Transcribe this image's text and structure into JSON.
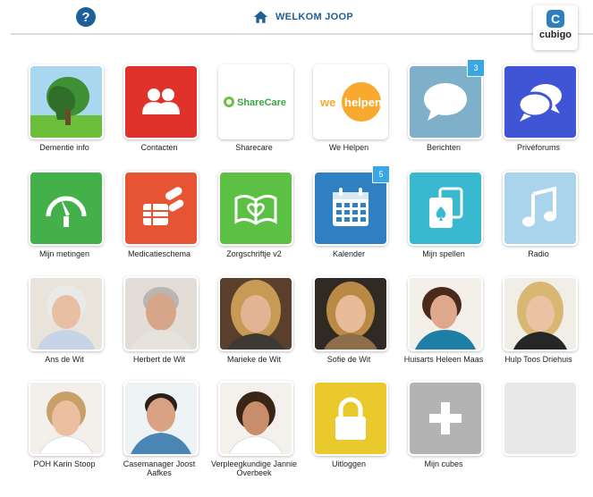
{
  "header": {
    "help_icon": "?",
    "home_icon": "home-icon",
    "title": "WELKOM JOOP",
    "brand_letter": "C",
    "brand_name": "cubigo"
  },
  "tiles": [
    {
      "label": "Dementie info",
      "icon": "tree-head-photo"
    },
    {
      "label": "Contacten",
      "icon": "contacts-icon",
      "color": "#e0322b"
    },
    {
      "label": "Sharecare",
      "icon": "sharecare-logo",
      "logo_text": "ShareCare"
    },
    {
      "label": "We Helpen",
      "icon": "we-helpen-logo",
      "logo_text_1": "we",
      "logo_text_2": "helpen"
    },
    {
      "label": "Berichten",
      "icon": "chat-bubble-icon",
      "color": "#7fb0c9",
      "badge": "3"
    },
    {
      "label": "Privéforums",
      "icon": "forums-icon",
      "color": "#3f55d6"
    },
    {
      "label": "Mijn metingen",
      "icon": "gauge-icon",
      "color": "#44b04a"
    },
    {
      "label": "Medicatieschema",
      "icon": "medication-icon",
      "color": "#e65434"
    },
    {
      "label": "Zorgschriftje v2",
      "icon": "book-heart-icon",
      "color": "#5cc044"
    },
    {
      "label": "Kalender",
      "icon": "calendar-icon",
      "color": "#2f7fc3",
      "badge": "5"
    },
    {
      "label": "Mijn spellen",
      "icon": "cards-icon",
      "color": "#39b9cf"
    },
    {
      "label": "Radio",
      "icon": "music-icon",
      "color": "#a9d4ec"
    },
    {
      "label": "Ans de Wit",
      "icon": "avatar-elderly-woman"
    },
    {
      "label": "Herbert de Wit",
      "icon": "avatar-man-grey"
    },
    {
      "label": "Marieke de Wit",
      "icon": "avatar-woman-blonde"
    },
    {
      "label": "Sofie de Wit",
      "icon": "avatar-woman-smiling"
    },
    {
      "label": "Huisarts Heleen Maas",
      "icon": "avatar-doctor"
    },
    {
      "label": "Hulp Toos Driehuis",
      "icon": "avatar-blonde-helper"
    },
    {
      "label": "POH Karin Stoop",
      "icon": "avatar-nurse"
    },
    {
      "label": "Casemanager Joost Aafkes",
      "icon": "avatar-young-man"
    },
    {
      "label": "Verpleegkundige Jannie Overbeek",
      "icon": "avatar-nurse-dark"
    },
    {
      "label": "Uitloggen",
      "icon": "lock-icon",
      "color": "#e9c92c"
    },
    {
      "label": "Mijn cubes",
      "icon": "plus-icon",
      "color": "#b3b3b3"
    },
    {
      "label": "",
      "icon": "empty-slot",
      "color": "#e8e8e8"
    }
  ]
}
